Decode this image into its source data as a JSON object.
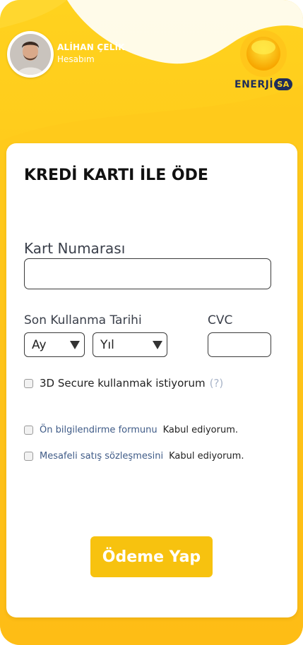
{
  "user": {
    "name": "ALİHAN ÇELİK",
    "account_link": "Hesabım"
  },
  "logo": {
    "text": "ENERJİ",
    "badge": "SA",
    "sun_icon": "sun-icon"
  },
  "form": {
    "title": "KREDİ KARTI İLE ÖDE",
    "card_number_label": "Kart Numarası",
    "card_number_value": "",
    "expiry_label": "Son Kullanma Tarihi",
    "month_selected": "Ay",
    "year_selected": "Yıl",
    "cvc_label": "CVC",
    "cvc_value": "",
    "secure_label": "3D Secure kullanmak istiyorum",
    "secure_help": "(?)",
    "preinfo_link": "Ön bilgilendirme formunu",
    "preinfo_accept": "Kabul ediyorum.",
    "distance_link": "Mesafeli satış sözleşmesini",
    "distance_accept": "Kabul ediyorum.",
    "submit_label": "Ödeme Yap"
  },
  "colors": {
    "background_yellow": "#FFC61A",
    "button_yellow": "#F7C20F",
    "brand_navy": "#1f2d5a",
    "link_blue": "#3f5b87",
    "help_gray": "#a8b4c8"
  }
}
